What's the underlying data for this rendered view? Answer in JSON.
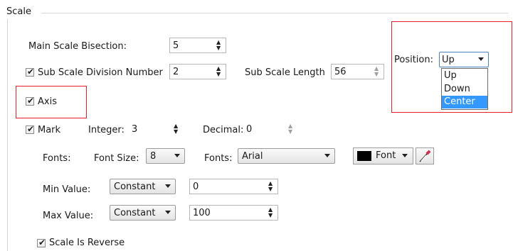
{
  "group_title": "Scale",
  "main_scale_bisection": {
    "label": "Main Scale Bisection:",
    "value": "5"
  },
  "sub_scale_division": {
    "label": "Sub Scale Division Number",
    "value": "2",
    "checked": true
  },
  "sub_scale_length": {
    "label": "Sub Scale Length",
    "value": "56"
  },
  "position": {
    "label": "Position:",
    "value": "Up",
    "options": [
      "Up",
      "Down",
      "Center"
    ],
    "highlighted": "Center"
  },
  "axis": {
    "label": "Axis",
    "checked": true
  },
  "mark": {
    "label": "Mark",
    "checked": true,
    "integer_label": "Integer:",
    "integer_value": "3",
    "decimal_label": "Decimal:",
    "decimal_value": "0"
  },
  "fonts_row": {
    "label": "Fonts:",
    "font_size_label": "Font Size:",
    "font_size_value": "8",
    "fonts_label": "Fonts:",
    "font_value": "Arial",
    "font_button_label": "Font",
    "font_color": "#000000"
  },
  "min_value": {
    "label": "Min Value:",
    "mode": "Constant",
    "value": "0"
  },
  "max_value": {
    "label": "Max Value:",
    "mode": "Constant",
    "value": "100"
  },
  "scale_is_reverse": {
    "label": "Scale Is Reverse",
    "checked": true
  },
  "check_glyph": "✔",
  "up_arrow_glyph": "▲",
  "down_arrow_glyph": "▼",
  "colors": {
    "highlight_box": "#e8222a",
    "selection": "#3399ff"
  }
}
